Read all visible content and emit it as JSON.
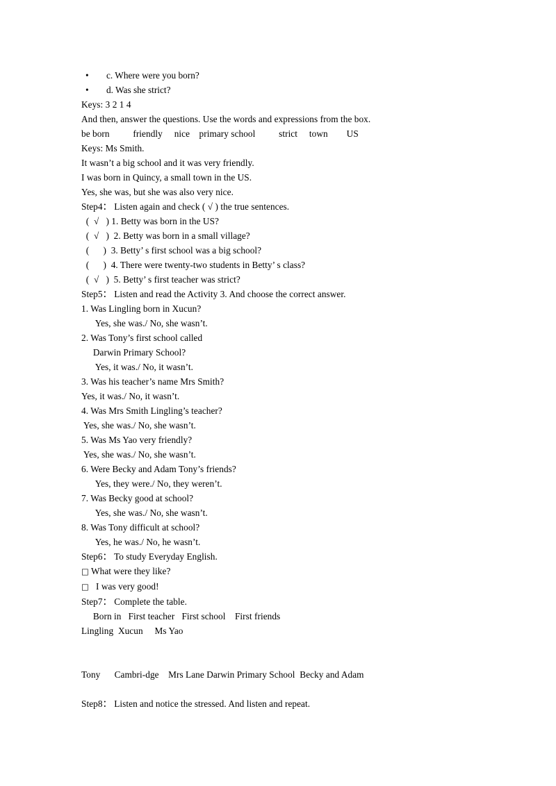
{
  "document": {
    "lines": [
      {
        "id": "l1",
        "type": "bullet",
        "bullet": "•",
        "text": "c. Where were you born?"
      },
      {
        "id": "l2",
        "type": "bullet",
        "bullet": "•",
        "text": "d. Was she strict?"
      },
      {
        "id": "l3",
        "type": "text",
        "text": "Keys: 3 2 1 4"
      },
      {
        "id": "l4",
        "type": "text",
        "text": "And then, answer the questions. Use the words and expressions from the box."
      },
      {
        "id": "l5",
        "type": "text",
        "text": "be born          friendly     nice    primary school          strict     town        US"
      },
      {
        "id": "l6",
        "type": "text",
        "text": "Keys: Ms Smith."
      },
      {
        "id": "l7",
        "type": "text",
        "text": "It wasn’t a big school and it was very friendly."
      },
      {
        "id": "l8",
        "type": "text",
        "text": "I was born in Quincy, a small town in the US."
      },
      {
        "id": "l9",
        "type": "text",
        "text": "Yes, she was, but she was also very nice."
      },
      {
        "id": "l10",
        "type": "text",
        "text": "Step4： Listen again and check ( √ ) the true sentences."
      },
      {
        "id": "l11",
        "type": "text",
        "text": "  (  √   ) 1. Betty was born in the US?"
      },
      {
        "id": "l12",
        "type": "text",
        "text": "  (  √   )  2. Betty was born in a small village?"
      },
      {
        "id": "l13",
        "type": "text",
        "text": "  (      )  3. Betty’ s first school was a big school?"
      },
      {
        "id": "l14",
        "type": "text",
        "text": "  (      )  4. There were twenty-two students in Betty’ s class?"
      },
      {
        "id": "l15",
        "type": "text",
        "text": "  (  √   )  5. Betty’ s first teacher was strict?"
      },
      {
        "id": "l16",
        "type": "text",
        "text": "Step5： Listen and read the Activity 3. And choose the correct answer."
      },
      {
        "id": "l17",
        "type": "text",
        "text": "1. Was Lingling born in Xucun?"
      },
      {
        "id": "l18",
        "type": "text",
        "text": "      Yes, she was./ No, she wasn’t."
      },
      {
        "id": "l19",
        "type": "text",
        "text": "2. Was Tony’s first school called"
      },
      {
        "id": "l20",
        "type": "text",
        "text": "     Darwin Primary School?"
      },
      {
        "id": "l21",
        "type": "text",
        "text": "      Yes, it was./ No, it wasn’t."
      },
      {
        "id": "l22",
        "type": "text",
        "text": "3. Was his teacher’s name Mrs Smith?"
      },
      {
        "id": "l23",
        "type": "text",
        "text": "Yes, it was./ No, it wasn’t."
      },
      {
        "id": "l24",
        "type": "text",
        "text": "4. Was Mrs Smith Lingling’s teacher?"
      },
      {
        "id": "l25",
        "type": "text",
        "text": " Yes, she was./ No, she wasn’t."
      },
      {
        "id": "l26",
        "type": "text",
        "text": "5. Was Ms Yao very friendly?"
      },
      {
        "id": "l27",
        "type": "text",
        "text": " Yes, she was./ No, she wasn’t."
      },
      {
        "id": "l28",
        "type": "text",
        "text": "6. Were Becky and Adam Tony’s friends?"
      },
      {
        "id": "l29",
        "type": "text",
        "text": "      Yes, they were./ No, they weren’t."
      },
      {
        "id": "l30",
        "type": "text",
        "text": "7. Was Becky good at school?"
      },
      {
        "id": "l31",
        "type": "text",
        "text": "      Yes, she was./ No, she wasn’t."
      },
      {
        "id": "l32",
        "type": "text",
        "text": "8. Was Tony difficult at school?"
      },
      {
        "id": "l33",
        "type": "text",
        "text": "      Yes, he was./ No, he wasn’t."
      },
      {
        "id": "l34",
        "type": "text",
        "text": "Step6： To study Everyday English."
      },
      {
        "id": "l35",
        "type": "tofu",
        "glyph": "□",
        "text": " What were they like?"
      },
      {
        "id": "l36",
        "type": "tofu",
        "glyph": "□",
        "text": "   I was very good!"
      },
      {
        "id": "l37",
        "type": "text",
        "text": "Step7： Complete the table."
      },
      {
        "id": "l38",
        "type": "text",
        "text": "     Born in   First teacher   First school    First friends"
      },
      {
        "id": "l39",
        "type": "text",
        "text": "Lingling  Xucun     Ms Yao"
      },
      {
        "id": "l40",
        "type": "blank",
        "size": "md"
      },
      {
        "id": "l41",
        "type": "text",
        "text": "Tony      Cambri-dge    Mrs Lane Darwin Primary School  Becky and Adam"
      },
      {
        "id": "l42",
        "type": "blank",
        "size": "sm"
      },
      {
        "id": "l43",
        "type": "text",
        "text": "Step8： Listen and notice the stressed. And listen and repeat."
      }
    ],
    "table_data": {
      "headers": [
        "Born in",
        "First teacher",
        "First school",
        "First friends"
      ],
      "rows": [
        {
          "name": "Lingling",
          "born_in": "Xucun",
          "first_teacher": "Ms Yao",
          "first_school": "",
          "first_friends": ""
        },
        {
          "name": "Tony",
          "born_in": "Cambri-dge",
          "first_teacher": "Mrs Lane",
          "first_school": "Darwin Primary School",
          "first_friends": "Becky and Adam"
        }
      ]
    },
    "word_box": [
      "be born",
      "friendly",
      "nice",
      "primary school",
      "strict",
      "town",
      "US"
    ],
    "keys": {
      "ordering": "3 2 1 4",
      "teacher": "Ms Smith."
    },
    "checklist": [
      {
        "n": "1",
        "checked": "√",
        "text": "Betty was born in the US?"
      },
      {
        "n": "2",
        "checked": "√",
        "text": "Betty was born in a small village?"
      },
      {
        "n": "3",
        "checked": "",
        "text": "Betty’ s first school was a big school?"
      },
      {
        "n": "4",
        "checked": "",
        "text": "There were twenty-two students in Betty’ s class?"
      },
      {
        "n": "5",
        "checked": "√",
        "text": "Betty’ s first teacher was strict?"
      }
    ],
    "colors": {
      "text": "#000000",
      "background": "#ffffff"
    }
  }
}
